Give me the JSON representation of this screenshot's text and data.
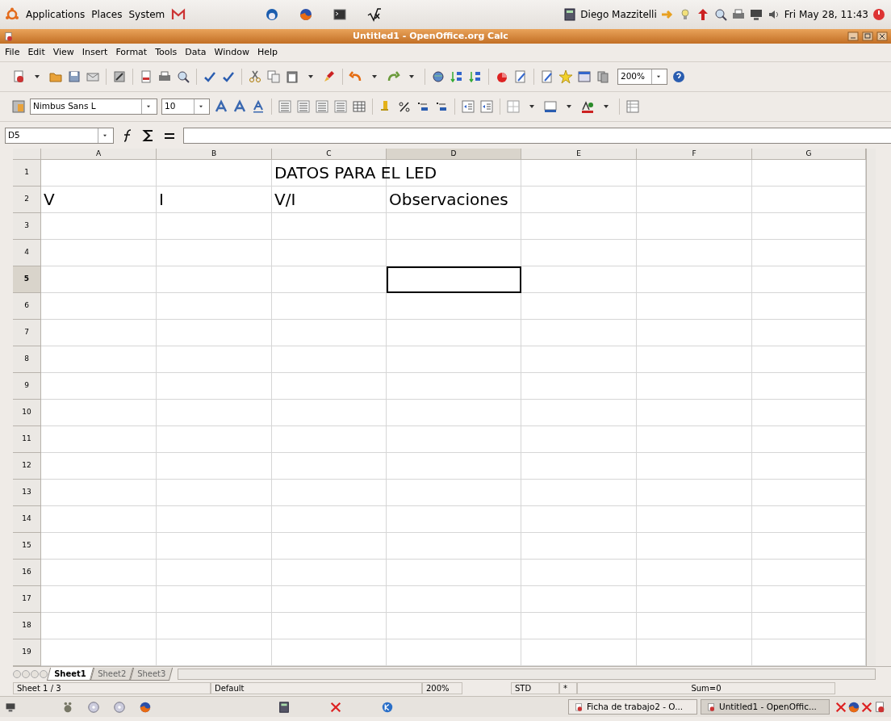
{
  "top_panel": {
    "menus": [
      "Applications",
      "Places",
      "System"
    ],
    "user": "Diego Mazzitelli",
    "clock": "Fri May 28, 11:43"
  },
  "window": {
    "title": "Untitled1 - OpenOffice.org Calc"
  },
  "menu_bar": [
    "File",
    "Edit",
    "View",
    "Insert",
    "Format",
    "Tools",
    "Data",
    "Window",
    "Help"
  ],
  "toolbar": {
    "zoom": "200%"
  },
  "format_bar": {
    "font_name": "Nimbus Sans L",
    "font_size": "10"
  },
  "formula_bar": {
    "cell_ref": "D5"
  },
  "columns": [
    {
      "label": "A",
      "selected": false
    },
    {
      "label": "B",
      "selected": false
    },
    {
      "label": "C",
      "selected": false
    },
    {
      "label": "D",
      "selected": true
    },
    {
      "label": "E",
      "selected": false
    },
    {
      "label": "F",
      "selected": false
    },
    {
      "label": "G",
      "selected": false
    }
  ],
  "rows": [
    {
      "label": "1",
      "selected": false,
      "cells": [
        "",
        "",
        "DATOS PARA EL LED",
        "",
        "",
        "",
        ""
      ]
    },
    {
      "label": "2",
      "selected": false,
      "cells": [
        "V",
        "I",
        "V/I",
        "Observaciones",
        "",
        "",
        ""
      ]
    },
    {
      "label": "3",
      "selected": false,
      "cells": []
    },
    {
      "label": "4",
      "selected": false,
      "cells": []
    },
    {
      "label": "5",
      "selected": true,
      "cells": []
    },
    {
      "label": "6",
      "selected": false,
      "cells": []
    },
    {
      "label": "7",
      "selected": false,
      "cells": []
    },
    {
      "label": "8",
      "selected": false,
      "cells": []
    },
    {
      "label": "9",
      "selected": false,
      "cells": []
    },
    {
      "label": "10",
      "selected": false,
      "cells": []
    },
    {
      "label": "11",
      "selected": false,
      "cells": []
    },
    {
      "label": "12",
      "selected": false,
      "cells": []
    },
    {
      "label": "13",
      "selected": false,
      "cells": []
    },
    {
      "label": "14",
      "selected": false,
      "cells": []
    },
    {
      "label": "15",
      "selected": false,
      "cells": []
    },
    {
      "label": "16",
      "selected": false,
      "cells": []
    },
    {
      "label": "17",
      "selected": false,
      "cells": []
    },
    {
      "label": "18",
      "selected": false,
      "cells": []
    },
    {
      "label": "19",
      "selected": false,
      "cells": []
    }
  ],
  "sheet_tabs": [
    {
      "label": "Sheet1",
      "selected": true
    },
    {
      "label": "Sheet2",
      "selected": false
    },
    {
      "label": "Sheet3",
      "selected": false
    }
  ],
  "status_bar": [
    "Sheet 1 / 3",
    "Default",
    "200%",
    "STD",
    "*",
    "Sum=0"
  ],
  "taskbar": [
    {
      "label": "Ficha de trabajo2 - O...",
      "selected": false
    },
    {
      "label": "Untitled1 - OpenOffic...",
      "selected": true
    }
  ]
}
